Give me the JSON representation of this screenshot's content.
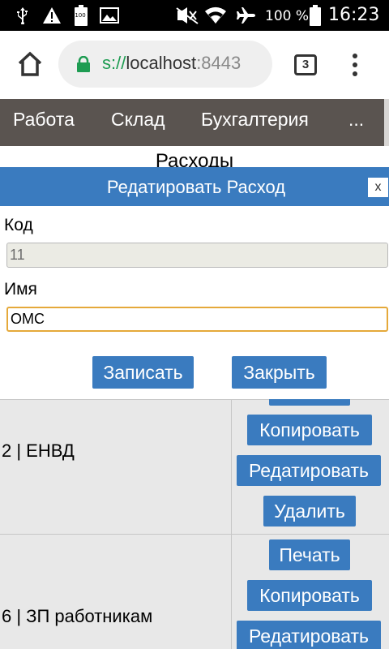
{
  "status_bar": {
    "battery_percent": "100 %",
    "time": "16:23",
    "battery_badge": "100",
    "icons": [
      "usb-icon",
      "warning-icon",
      "battery-small-icon",
      "image-icon",
      "mute-icon",
      "wifi-icon",
      "airplane-icon",
      "battery-icon"
    ]
  },
  "browser": {
    "url_scheme": "s://",
    "url_host": "localhost",
    "url_port": ":8443",
    "tab_count": "3",
    "accent_secure": "#1e9c52"
  },
  "site_nav": {
    "items": [
      {
        "label": "Работа"
      },
      {
        "label": "Склад"
      },
      {
        "label": "Бухгалтерия"
      },
      {
        "label": "..."
      }
    ]
  },
  "page": {
    "heading": "Расходы"
  },
  "modal": {
    "title": "Редатировать Расход",
    "close_label": "x",
    "code_label": "Код",
    "code_value": "11",
    "name_label": "Имя",
    "name_value": "ОМС",
    "save_label": "Записать",
    "close_button_label": "Закрыть",
    "accent": "#3a7bbf"
  },
  "table": {
    "rows": [
      {
        "text": "2 | ЕНВД",
        "actions": {
          "copy": "Копировать",
          "edit": "Редатировать",
          "delete": "Удалить"
        }
      },
      {
        "text": "6 | ЗП работникам",
        "actions": {
          "print": "Печать",
          "copy": "Копировать",
          "edit": "Редатировать"
        }
      }
    ]
  }
}
